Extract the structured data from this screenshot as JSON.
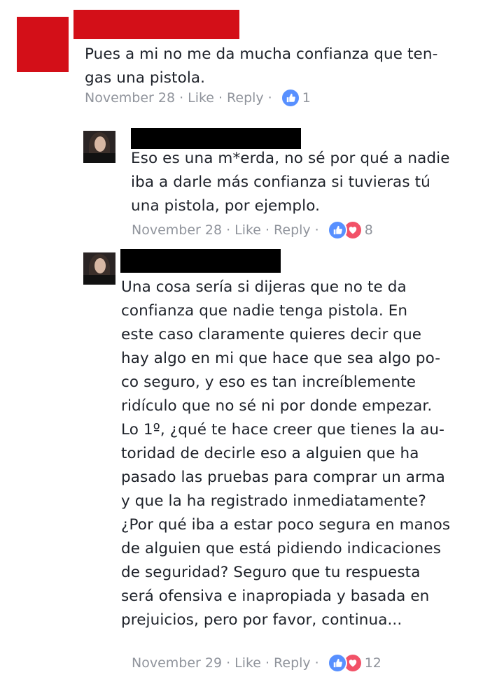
{
  "colors": {
    "redacted_name": "#c8000f",
    "redacted_name_black": "#000000",
    "like": "#5890ff",
    "love": "#f25268",
    "meta": "#90949c"
  },
  "comments": [
    {
      "text": "Pues a mi no me da mucha confianza que ten-\ngas una pistola.",
      "date": "November 28",
      "like_label": "Like",
      "reply_label": "Reply",
      "reactions": [
        "like-icon"
      ],
      "count": "1"
    },
    {
      "text": "Eso es una m*erda, no sé por qué a nadie\niba a darle más confianza si tuvieras tú\nuna pistola, por ejemplo.",
      "date": "November 28",
      "like_label": "Like",
      "reply_label": "Reply",
      "reactions": [
        "like-icon",
        "heart-icon"
      ],
      "count": "8"
    },
    {
      "text": "Una cosa sería si dijeras que no te da\nconfianza que nadie tenga pistola. En\neste caso claramente quieres decir que\nhay algo en mi que hace que sea algo po-\nco seguro, y eso es tan increíblemente\nridículo que no sé ni por donde empezar.\nLo 1º, ¿qué te hace creer que tienes la au-\ntoridad de decirle eso a alguien que ha\npasado las pruebas para comprar un arma\ny que la ha registrado inmediatamente?\n¿Por qué iba a estar poco segura en manos\nde alguien que está pidiendo indicaciones\nde seguridad? Seguro que tu respuesta\nserá ofensiva e inapropiada y basada en\nprejuicios, pero por favor, continua...",
      "date": "November 29",
      "like_label": "Like",
      "reply_label": "Reply",
      "reactions": [
        "like-icon",
        "heart-icon"
      ],
      "count": "12"
    }
  ],
  "separator": "·"
}
